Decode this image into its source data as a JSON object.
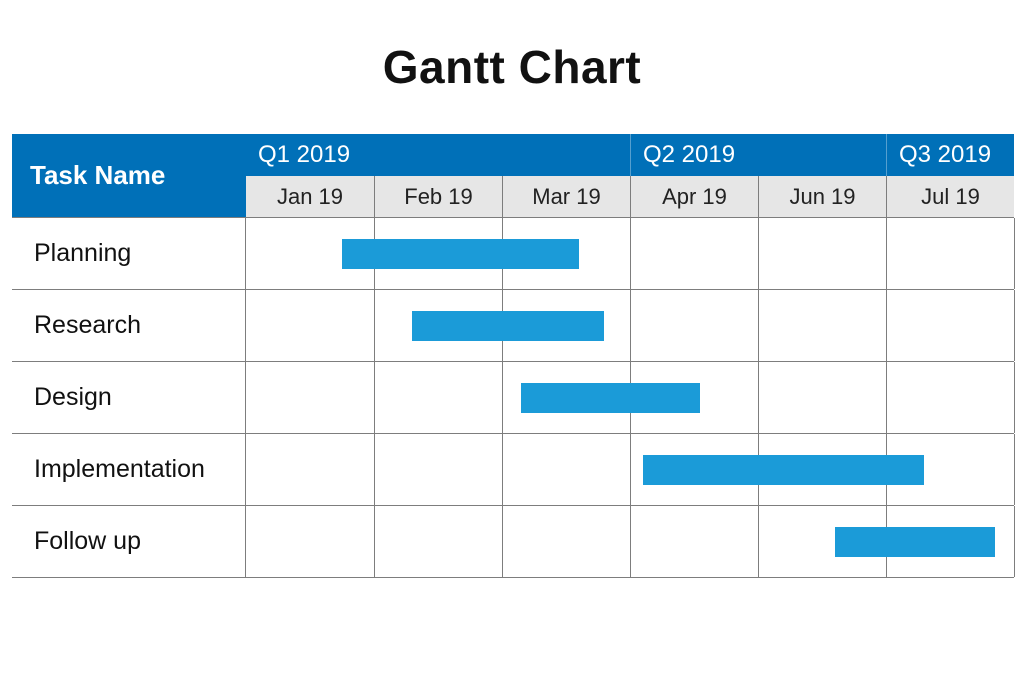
{
  "title": "Gantt Chart",
  "header_label": "Task Name",
  "quarters": [
    {
      "label": "Q1 2019",
      "span": 3
    },
    {
      "label": "Q2 2019",
      "span": 2
    },
    {
      "label": "Q3 2019",
      "span": 1
    }
  ],
  "months": [
    "Jan 19",
    "Feb 19",
    "Mar 19",
    "Apr 19",
    "Jun 19",
    "Jul 19"
  ],
  "tasks": [
    {
      "name": "Planning",
      "start": 0.75,
      "end": 2.6
    },
    {
      "name": "Research",
      "start": 1.3,
      "end": 2.8
    },
    {
      "name": "Design",
      "start": 2.15,
      "end": 3.55
    },
    {
      "name": "Implementation",
      "start": 3.1,
      "end": 5.3
    },
    {
      "name": "Follow up",
      "start": 4.6,
      "end": 5.85
    }
  ],
  "colors": {
    "header_blue": "#0070b8",
    "bar_blue": "#1b9bd8"
  },
  "chart_data": {
    "type": "bar",
    "title": "Gantt Chart",
    "x_axis": {
      "categories": [
        "Jan 19",
        "Feb 19",
        "Mar 19",
        "Apr 19",
        "Jun 19",
        "Jul 19"
      ],
      "groups": [
        "Q1 2019",
        "Q1 2019",
        "Q1 2019",
        "Q2 2019",
        "Q2 2019",
        "Q3 2019"
      ]
    },
    "y_axis": {
      "categories": [
        "Planning",
        "Research",
        "Design",
        "Implementation",
        "Follow up"
      ]
    },
    "series": [
      {
        "name": "Planning",
        "start_month": "Jan 19",
        "end_month": "Mar 19",
        "start": 0.75,
        "end": 2.6
      },
      {
        "name": "Research",
        "start_month": "Feb 19",
        "end_month": "Mar 19",
        "start": 1.3,
        "end": 2.8
      },
      {
        "name": "Design",
        "start_month": "Mar 19",
        "end_month": "Apr 19",
        "start": 2.15,
        "end": 3.55
      },
      {
        "name": "Implementation",
        "start_month": "Apr 19",
        "end_month": "Jul 19",
        "start": 3.1,
        "end": 5.3
      },
      {
        "name": "Follow up",
        "start_month": "Jun 19",
        "end_month": "Jul 19",
        "start": 4.6,
        "end": 5.85
      }
    ],
    "x_unit": "month-index (0 = start of Jan 19 column, 6 = end of Jul 19 column)"
  }
}
